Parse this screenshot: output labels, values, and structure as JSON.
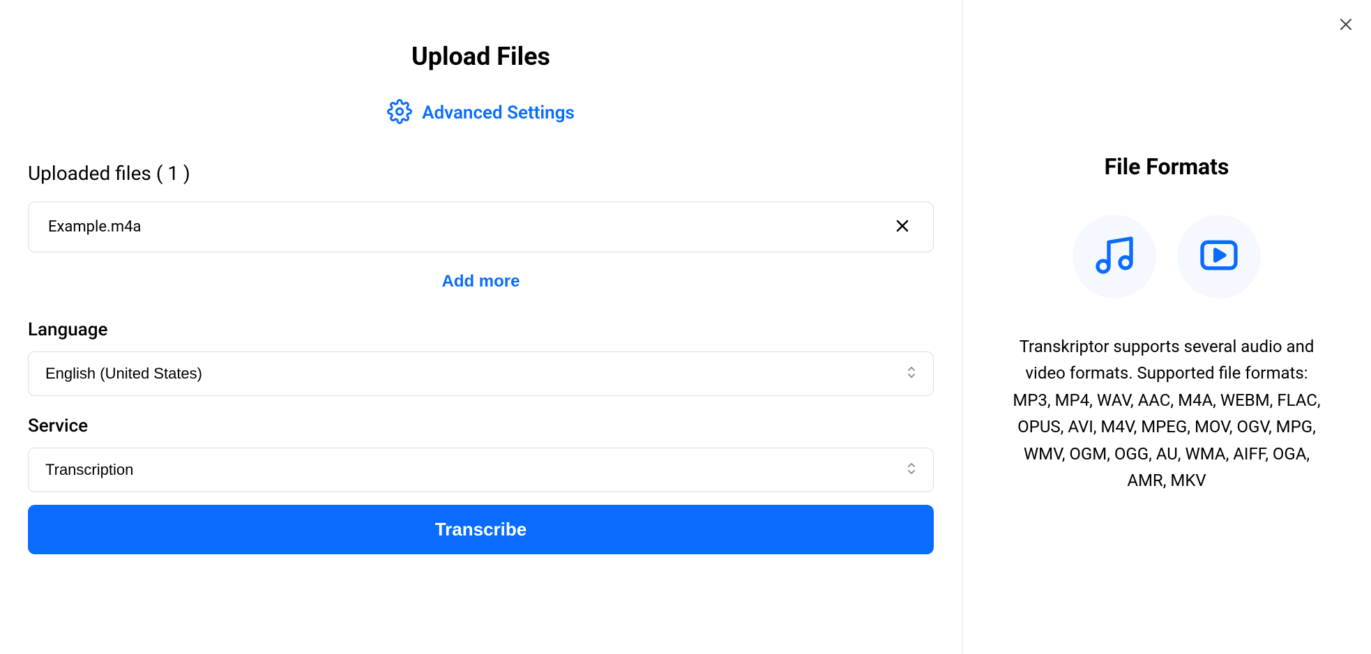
{
  "header": {
    "title": "Upload Files",
    "advanced_settings_label": "Advanced Settings"
  },
  "uploaded": {
    "heading": "Uploaded files ( 1 )",
    "files": [
      {
        "name": "Example.m4a"
      }
    ],
    "add_more_label": "Add more"
  },
  "language": {
    "label": "Language",
    "value": "English (United States)"
  },
  "service": {
    "label": "Service",
    "value": "Transcription"
  },
  "actions": {
    "transcribe_label": "Transcribe"
  },
  "formats": {
    "title": "File Formats",
    "description": "Transkriptor supports several audio and video formats. Supported file formats: MP3, MP4, WAV, AAC, M4A, WEBM, FLAC, OPUS, AVI, M4V, MPEG, MOV, OGV, MPG, WMV, OGM, OGG, AU, WMA, AIFF, OGA, AMR, MKV"
  },
  "colors": {
    "accent": "#0a6cff"
  }
}
